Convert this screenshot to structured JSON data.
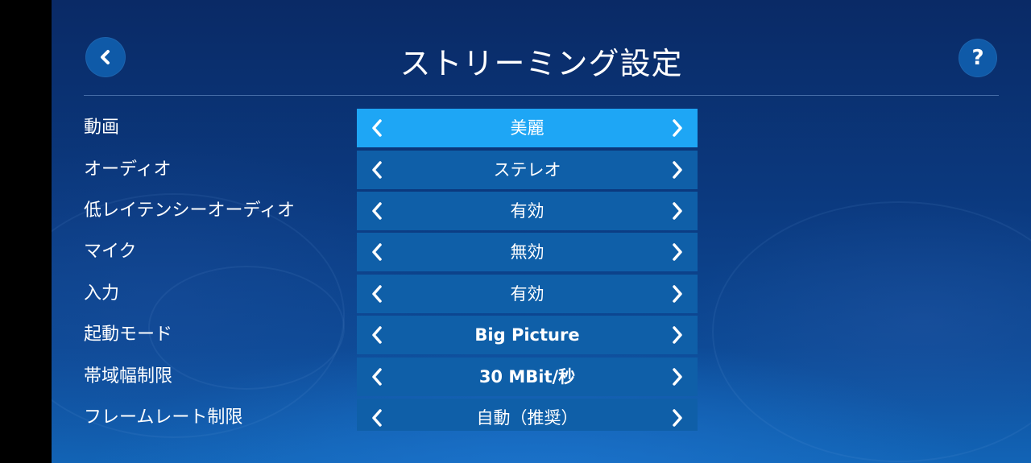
{
  "header": {
    "title": "ストリーミング設定",
    "help_label": "?"
  },
  "settings": [
    {
      "label": "動画",
      "value": "美麗",
      "active": true
    },
    {
      "label": "オーディオ",
      "value": "ステレオ",
      "active": false
    },
    {
      "label": "低レイテンシーオーディオ",
      "value": "有効",
      "active": false
    },
    {
      "label": "マイク",
      "value": "無効",
      "active": false
    },
    {
      "label": "入力",
      "value": "有効",
      "active": false
    },
    {
      "label": "起動モード",
      "value": "Big Picture",
      "active": false
    },
    {
      "label": "帯域幅制限",
      "value": "30 MBit/秒",
      "active": false
    },
    {
      "label": "フレームレート制限",
      "value": "自動（推奨）",
      "active": false
    }
  ],
  "icons": {
    "back": "chevron-left-icon",
    "help": "question-mark-icon",
    "prev": "chevron-left-icon",
    "next": "chevron-right-icon"
  },
  "colors": {
    "active_selector": "#1ea6f5",
    "selector": "#0f5fa8",
    "button": "#0f5aa8"
  }
}
